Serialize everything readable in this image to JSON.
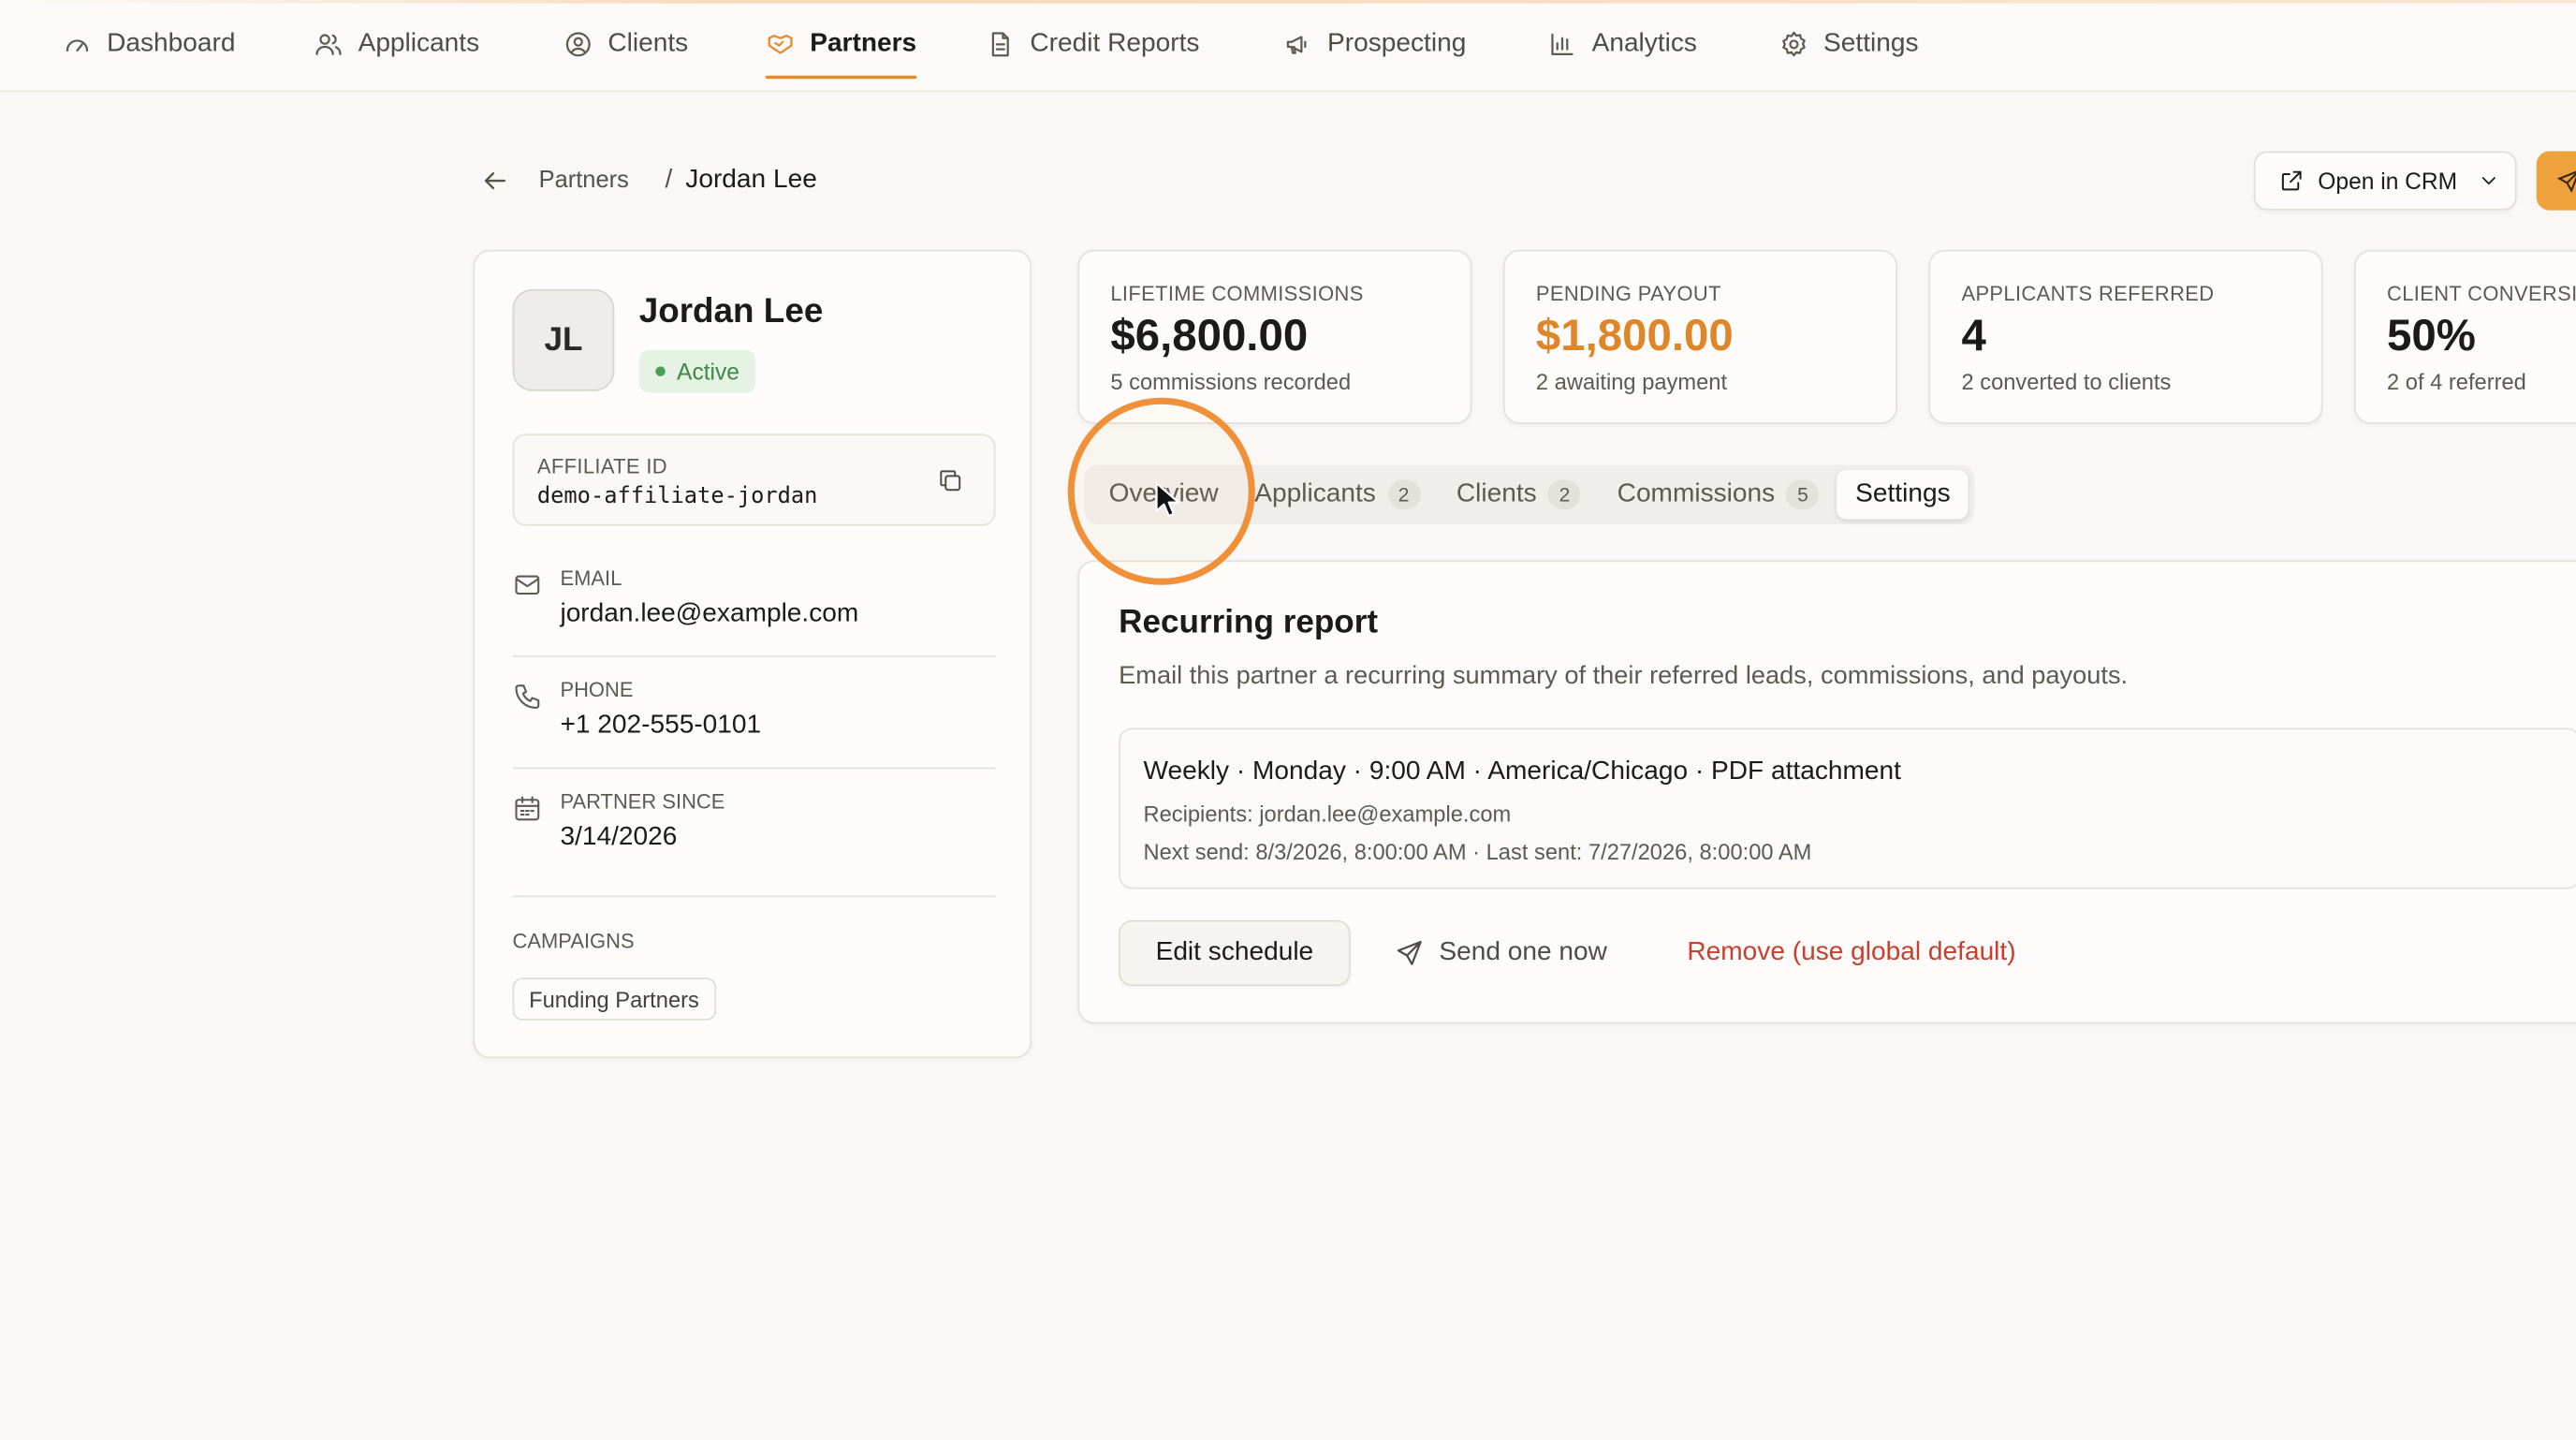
{
  "nav": {
    "items": [
      {
        "label": "Dashboard",
        "icon": "gauge-icon"
      },
      {
        "label": "Applicants",
        "icon": "users-icon"
      },
      {
        "label": "Clients",
        "icon": "user-circle-icon"
      },
      {
        "label": "Partners",
        "icon": "handshake-icon",
        "active": true
      },
      {
        "label": "Credit Reports",
        "icon": "document-icon"
      },
      {
        "label": "Prospecting",
        "icon": "megaphone-icon"
      },
      {
        "label": "Analytics",
        "icon": "bar-chart-icon"
      },
      {
        "label": "Settings",
        "icon": "gear-icon"
      }
    ]
  },
  "breadcrumb": {
    "parent": "Partners",
    "separator": "/",
    "current": "Jordan Lee"
  },
  "header_actions": {
    "open_crm_label": "Open in CRM"
  },
  "profile": {
    "initials": "JL",
    "name": "Jordan Lee",
    "status": "Active",
    "affiliate_id_label": "AFFILIATE ID",
    "affiliate_id": "demo-affiliate-jordan",
    "email_label": "EMAIL",
    "email": "jordan.lee@example.com",
    "phone_label": "PHONE",
    "phone": "+1 202-555-0101",
    "partner_since_label": "PARTNER SINCE",
    "partner_since": "3/14/2026",
    "campaigns_label": "CAMPAIGNS",
    "campaigns": [
      "Funding Partners"
    ]
  },
  "stats": [
    {
      "label": "LIFETIME COMMISSIONS",
      "value": "$6,800.00",
      "sub": "5 commissions recorded"
    },
    {
      "label": "PENDING PAYOUT",
      "value": "$1,800.00",
      "sub": "2 awaiting payment"
    },
    {
      "label": "APPLICANTS REFERRED",
      "value": "4",
      "sub": "2 converted to clients"
    },
    {
      "label": "CLIENT CONVERSIO",
      "value": "50%",
      "sub": "2 of 4 referred"
    }
  ],
  "tabs": [
    {
      "label": "Overview"
    },
    {
      "label": "Applicants",
      "count": "2"
    },
    {
      "label": "Clients",
      "count": "2"
    },
    {
      "label": "Commissions",
      "count": "5"
    },
    {
      "label": "Settings",
      "active": true
    }
  ],
  "recurring_report": {
    "title": "Recurring report",
    "description": "Email this partner a recurring summary of their referred leads, commissions, and payouts.",
    "schedule_summary": "Weekly · Monday · 9:00 AM · America/Chicago · PDF attachment",
    "recipients": "Recipients: jordan.lee@example.com",
    "timing": "Next send: 8/3/2026, 8:00:00 AM · Last sent: 7/27/2026, 8:00:00 AM",
    "edit_label": "Edit schedule",
    "send_label": "Send one now",
    "remove_label": "Remove (use global default)"
  },
  "colors": {
    "accent": "#e58b2c",
    "pending_value": "#df8628",
    "active_badge": "#3f8748",
    "danger": "#c5402f",
    "click_ring": "#f0913a"
  }
}
